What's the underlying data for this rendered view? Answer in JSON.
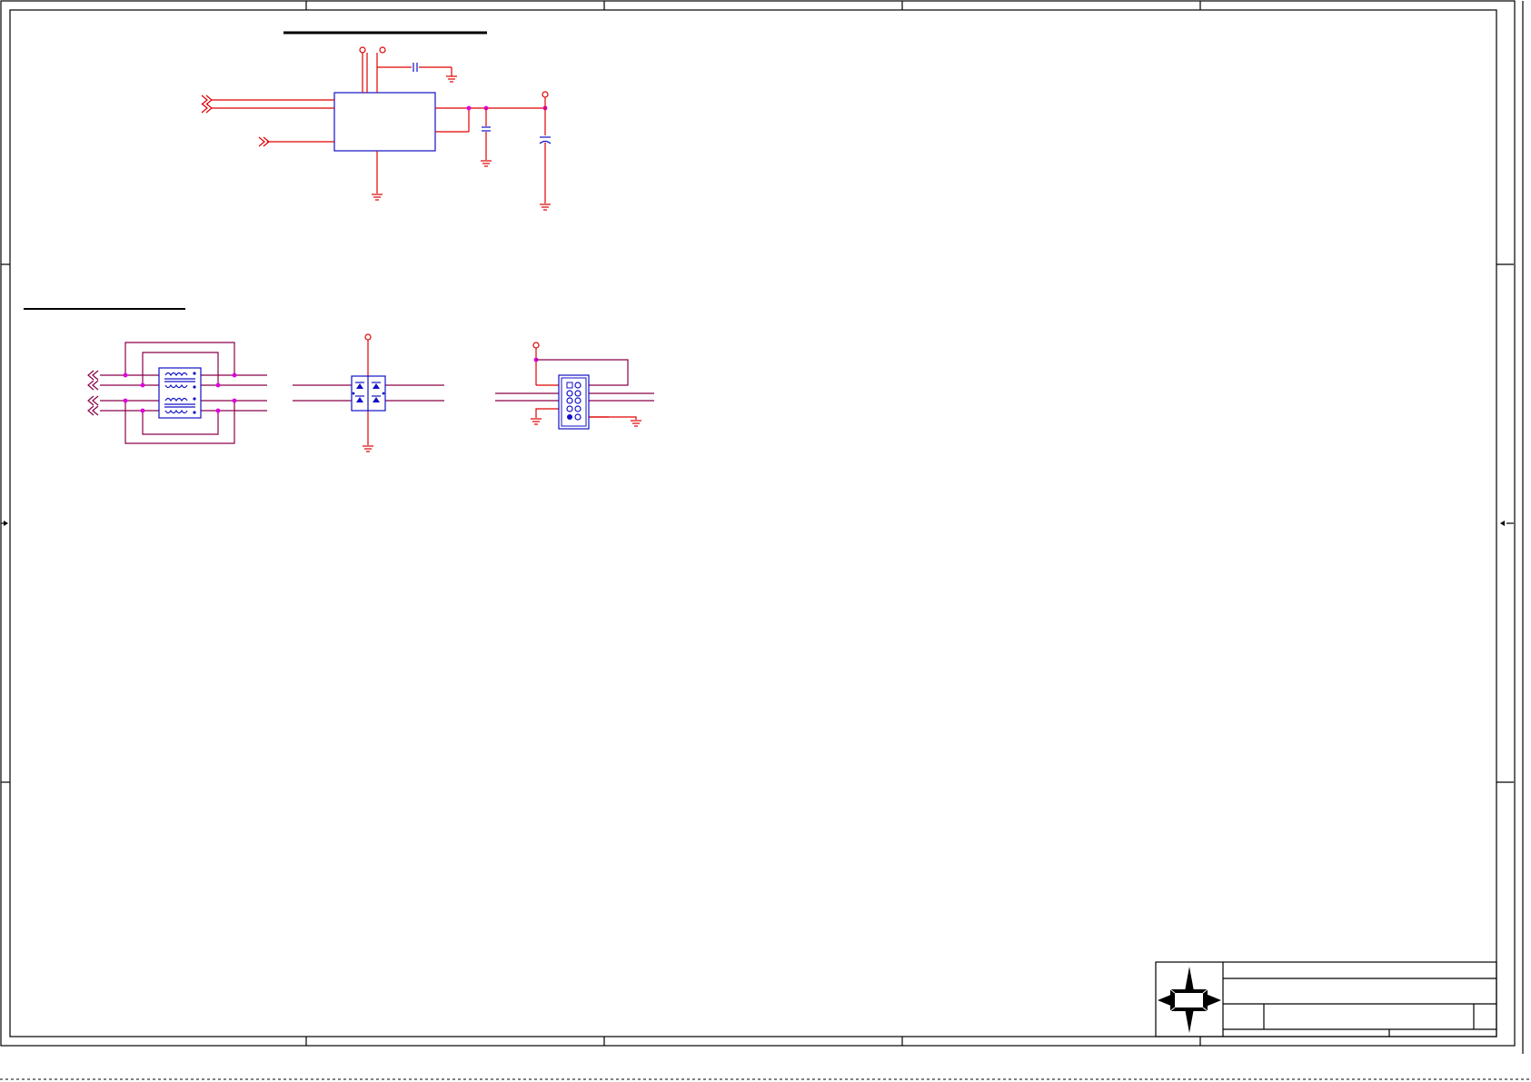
{
  "sheet": {
    "section_headings": [],
    "title_block": {
      "logo": "compass-star-logo",
      "fields": []
    }
  },
  "colors": {
    "wire": "#e00000",
    "net_bus": "#8b0046",
    "component": "#1010c8",
    "junction": "#e000e0",
    "frame": "#000000"
  },
  "icons": [
    "ground-icon",
    "power-port-icon",
    "offpage-connector-icon",
    "capacitor-icon",
    "transformer-icon",
    "tvs-diode-array-icon",
    "pin-header-icon"
  ]
}
